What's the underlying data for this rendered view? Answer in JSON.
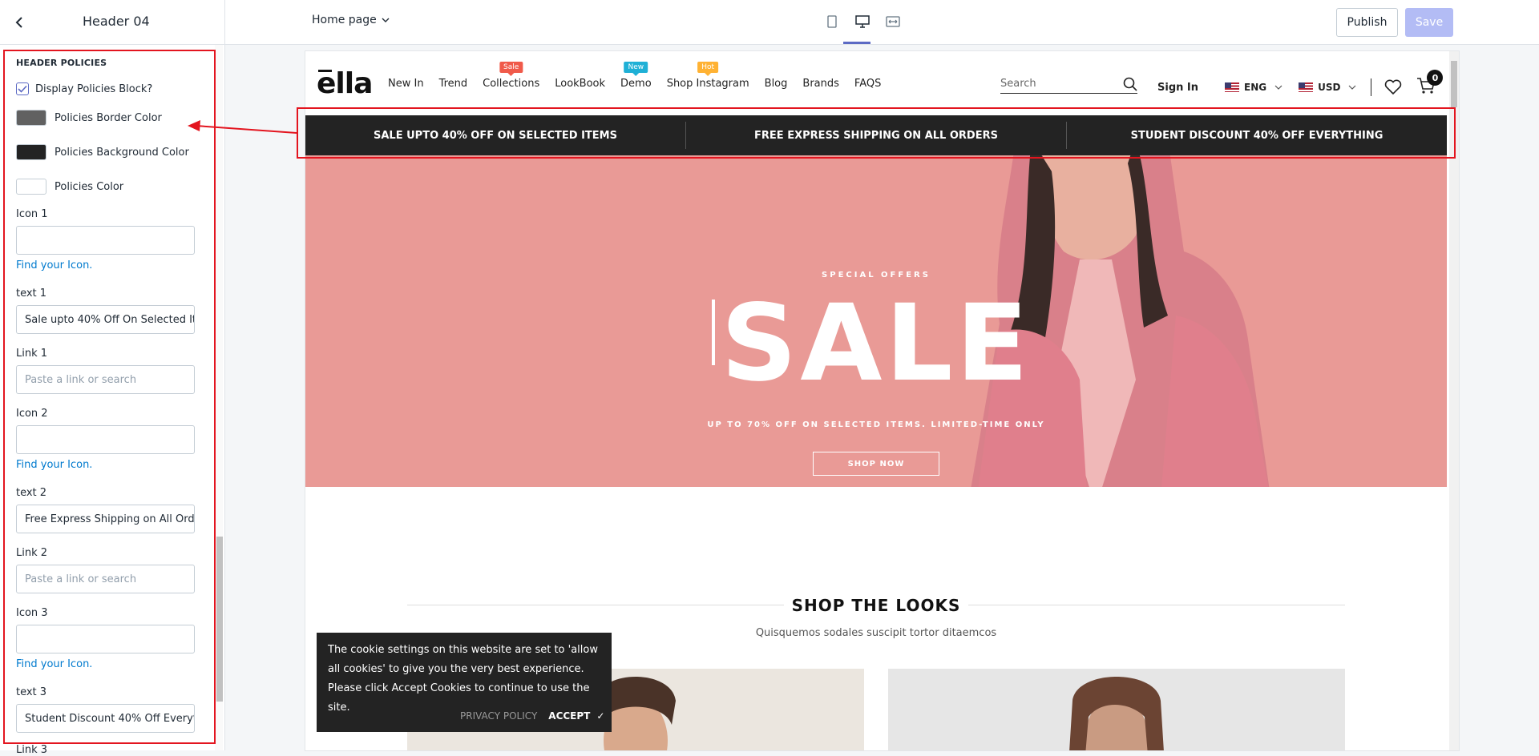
{
  "editor": {
    "section_title": "Header 04",
    "page_select": "Home page",
    "publish_label": "Publish",
    "save_label": "Save"
  },
  "sidebar": {
    "heading": "HEADER POLICIES",
    "display_policies_label": "Display Policies Block?",
    "display_policies_checked": true,
    "colors": [
      {
        "label": "Policies Border Color",
        "value": "#616161"
      },
      {
        "label": "Policies Background Color",
        "value": "#232323"
      },
      {
        "label": "Policies Color",
        "value": "#ffffff"
      }
    ],
    "icon1_label": "Icon 1",
    "icon1_value": "",
    "find_icon_1": "Find your Icon.",
    "text1_label": "text 1",
    "text1_value": "Sale upto 40% Off On Selected It",
    "link1_label": "Link 1",
    "link1_placeholder": "Paste a link or search",
    "icon2_label": "Icon 2",
    "icon2_value": "",
    "find_icon_2": "Find your Icon.",
    "text2_label": "text 2",
    "text2_value": "Free Express Shipping on All Ord",
    "link2_label": "Link 2",
    "link2_placeholder": "Paste a link or search",
    "icon3_label": "Icon 3",
    "icon3_value": "",
    "find_icon_3": "Find your Icon.",
    "text3_label": "text 3",
    "text3_value": "Student Discount 40% Off Everyt",
    "link3_label": "Link 3"
  },
  "store": {
    "logo": "ella",
    "nav": [
      {
        "label": "New In",
        "badge": null,
        "badge_color": null
      },
      {
        "label": "Trend",
        "badge": null,
        "badge_color": null
      },
      {
        "label": "Collections",
        "badge": "Sale",
        "badge_color": "#f05a4a"
      },
      {
        "label": "LookBook",
        "badge": null,
        "badge_color": null
      },
      {
        "label": "Demo",
        "badge": "New",
        "badge_color": "#1fb0d6"
      },
      {
        "label": "Shop Instagram",
        "badge": "Hot",
        "badge_color": "#ffb233"
      },
      {
        "label": "Blog",
        "badge": null,
        "badge_color": null
      },
      {
        "label": "Brands",
        "badge": null,
        "badge_color": null
      },
      {
        "label": "FAQS",
        "badge": null,
        "badge_color": null
      }
    ],
    "search_placeholder": "Search",
    "sign_in": "Sign In",
    "language": "ENG",
    "currency": "USD",
    "cart_count": "0",
    "policies": [
      "SALE UPTO 40% OFF ON SELECTED ITEMS",
      "FREE EXPRESS SHIPPING ON ALL ORDERS",
      "STUDENT DISCOUNT 40% OFF EVERYTHING"
    ],
    "hero": {
      "kicker": "SPECIAL OFFERS",
      "title": "SALE",
      "subtitle": "UP TO 70% OFF ON SELECTED ITEMS. LIMITED-TIME ONLY",
      "button": "SHOP NOW"
    },
    "looks_title": "SHOP THE LOOKS",
    "looks_sub": "Quisquemos sodales suscipit tortor ditaemcos",
    "cookie": {
      "text": "The cookie settings on this website are set to 'allow all cookies' to give you the very best experience. Please click Accept Cookies to continue to use the site.",
      "privacy": "PRIVACY POLICY",
      "accept": "ACCEPT"
    }
  }
}
